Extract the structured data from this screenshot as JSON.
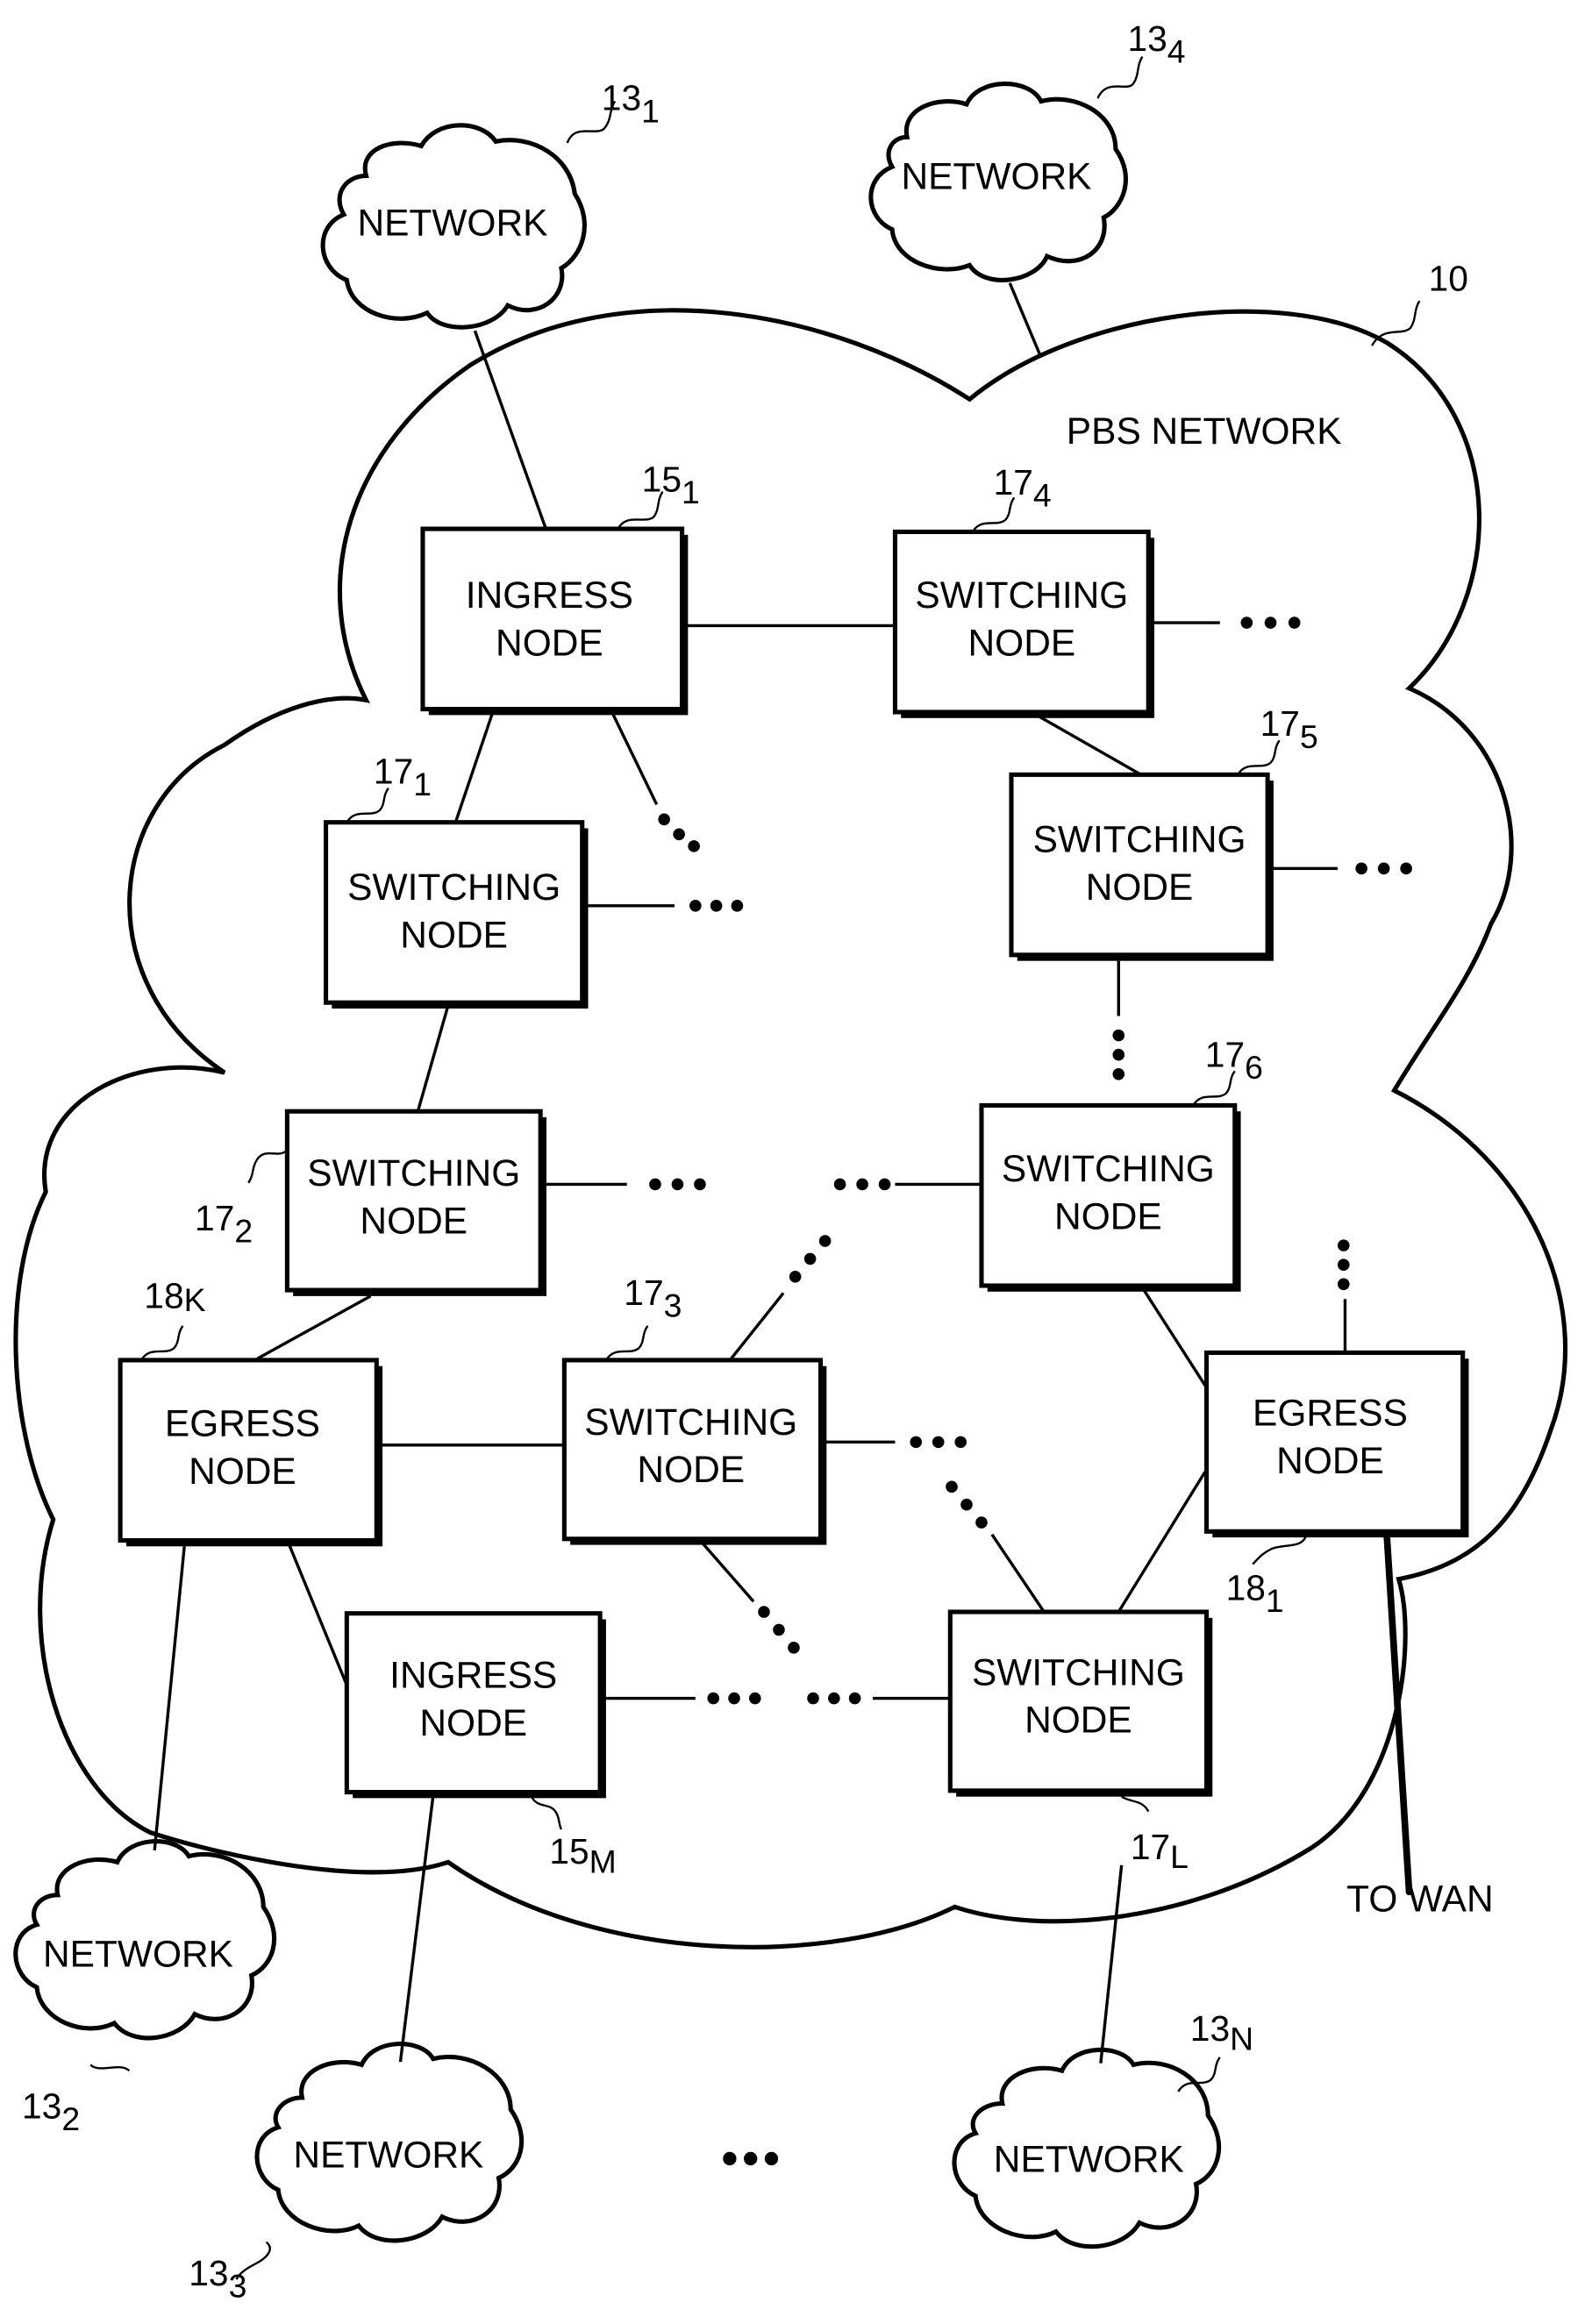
{
  "figure": {
    "title": "PBS NETWORK",
    "title_ref": "10",
    "networks": [
      {
        "id": "net-1",
        "label": "NETWORK",
        "ref": "13",
        "sub": "1"
      },
      {
        "id": "net-2",
        "label": "NETWORK",
        "ref": "13",
        "sub": "2"
      },
      {
        "id": "net-3",
        "label": "NETWORK",
        "ref": "13",
        "sub": "3"
      },
      {
        "id": "net-4",
        "label": "NETWORK",
        "ref": "13",
        "sub": "4"
      },
      {
        "id": "net-n",
        "label": "NETWORK",
        "ref": "13",
        "sub": "N"
      }
    ],
    "nodes": [
      {
        "id": "ingress-1",
        "line1": "INGRESS",
        "line2": "NODE",
        "ref": "15",
        "sub": "1"
      },
      {
        "id": "ingress-m",
        "line1": "INGRESS",
        "line2": "NODE",
        "ref": "15",
        "sub": "M"
      },
      {
        "id": "switch-1",
        "line1": "SWITCHING",
        "line2": "NODE",
        "ref": "17",
        "sub": "1"
      },
      {
        "id": "switch-2",
        "line1": "SWITCHING",
        "line2": "NODE",
        "ref": "17",
        "sub": "2"
      },
      {
        "id": "switch-3",
        "line1": "SWITCHING",
        "line2": "NODE",
        "ref": "17",
        "sub": "3"
      },
      {
        "id": "switch-4",
        "line1": "SWITCHING",
        "line2": "NODE",
        "ref": "17",
        "sub": "4"
      },
      {
        "id": "switch-5",
        "line1": "SWITCHING",
        "line2": "NODE",
        "ref": "17",
        "sub": "5"
      },
      {
        "id": "switch-6",
        "line1": "SWITCHING",
        "line2": "NODE",
        "ref": "17",
        "sub": "6"
      },
      {
        "id": "switch-l",
        "line1": "SWITCHING",
        "line2": "NODE",
        "ref": "17",
        "sub": "L"
      },
      {
        "id": "egress-k",
        "line1": "EGRESS",
        "line2": "NODE",
        "ref": "18",
        "sub": "K"
      },
      {
        "id": "egress-1",
        "line1": "EGRESS",
        "line2": "NODE",
        "ref": "18",
        "sub": "1"
      }
    ],
    "wan_label": "TO WAN",
    "ellipsis": "•••"
  }
}
